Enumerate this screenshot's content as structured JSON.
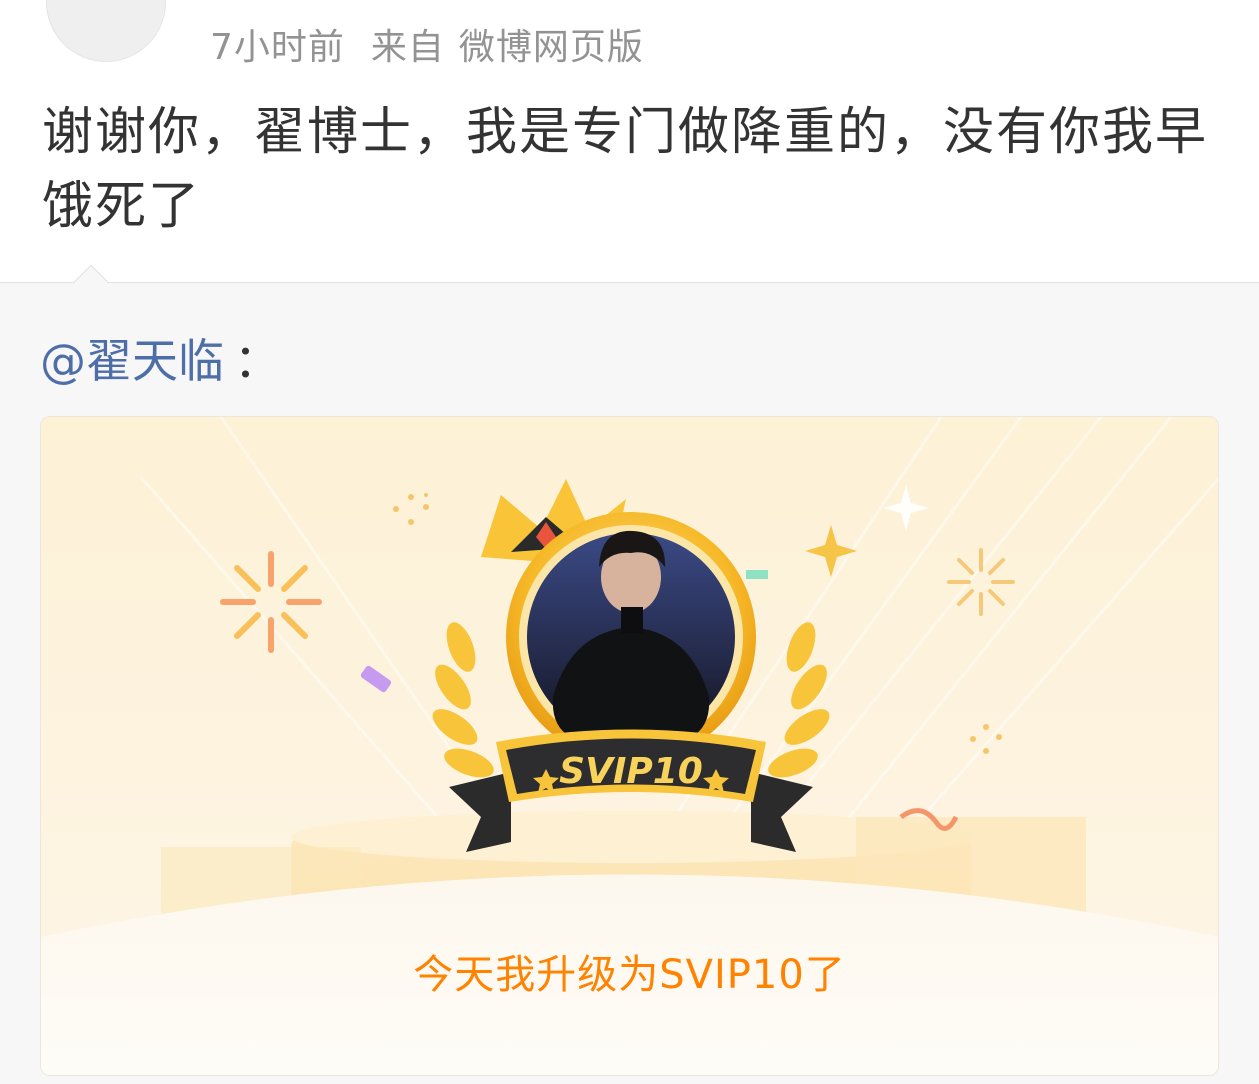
{
  "post": {
    "time": "7小时前",
    "source_label": "来自",
    "source": "微博网页版",
    "text": "谢谢你，翟博士，我是专门做降重的，没有你我早饿死了"
  },
  "repost": {
    "mention": "@翟天临",
    "colon": "：",
    "card": {
      "badge_label": "SVIP10",
      "caption": "今天我升级为SVIP10了"
    }
  },
  "colors": {
    "mention": "#4e6ea8",
    "caption": "#ff8200",
    "card_bg": "#fdf1d6",
    "gold": "#f7c43a"
  },
  "icons": [
    "crown-icon",
    "laurel-wreath-icon",
    "sparkle-icon",
    "firework-icon",
    "star-icon"
  ]
}
